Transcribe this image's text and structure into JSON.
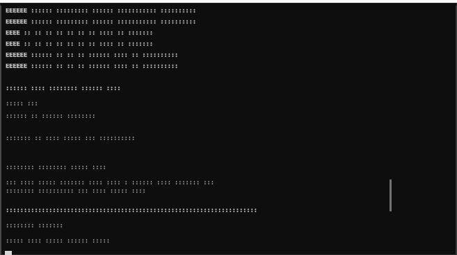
{
  "terminal": {
    "lines": [
      "EEEEEE  ::::::  :::::::::   ::::::  :::::::::::  ::::::::::",
      "EEEEEE  ::::::  :::::::::   ::::::  :::::::::::  ::::::::::",
      "EEEE    ::  ::  :: :: ::    ::  ::    :::: ::    :::::::",
      "EEEE    ::  ::  :: :: ::    ::  ::    :::: ::    :::::::",
      "EEEEEE  ::::::  :: :: ::    ::::::    :::: ::    ::::::::::",
      "EEEEEE  ::::::  :: :: ::    ::::::    :::: ::    ::::::::::",
      "               :::::: :::: :::::::: :::::: ::::",
      "::::: :::",
      ":::::: :: :::::: ::::::::",
      "::::::: ::          :::: ::::: ::: ::::::::::",
      ":::::::: :::::::: ::::: ::::",
      "::: :::: ::::: ::::::: :::: :::: : :::::: :::: :::::::   :::",
      "                 :::::::: :::::::::: ::: :::: ::::: ::::",
      "::::::::::::::::::::::::::::::::::::::::::::::::::::::::::::::::::::::",
      ":::::::: :::::::",
      "::::: :::: ::::: :::::: :::::"
    ]
  }
}
